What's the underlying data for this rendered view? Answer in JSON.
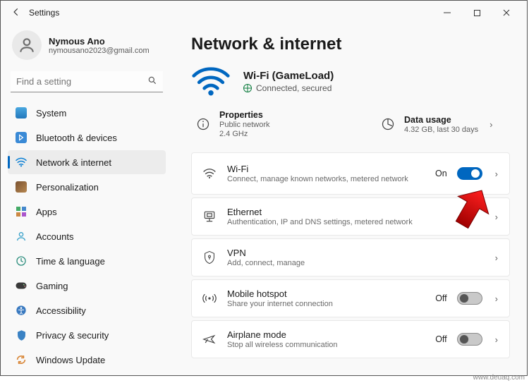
{
  "window": {
    "title": "Settings"
  },
  "profile": {
    "name": "Nymous Ano",
    "email": "nymousano2023@gmail.com"
  },
  "search": {
    "placeholder": "Find a setting"
  },
  "nav": {
    "items": [
      {
        "label": "System"
      },
      {
        "label": "Bluetooth & devices"
      },
      {
        "label": "Network & internet",
        "active": true
      },
      {
        "label": "Personalization"
      },
      {
        "label": "Apps"
      },
      {
        "label": "Accounts"
      },
      {
        "label": "Time & language"
      },
      {
        "label": "Gaming"
      },
      {
        "label": "Accessibility"
      },
      {
        "label": "Privacy & security"
      },
      {
        "label": "Windows Update"
      }
    ]
  },
  "page": {
    "heading": "Network & internet",
    "hero": {
      "ssid": "Wi-Fi (GameLoad)",
      "status": "Connected, secured"
    },
    "props": {
      "title": "Properties",
      "sub1": "Public network",
      "sub2": "2.4 GHz"
    },
    "usage": {
      "title": "Data usage",
      "sub": "4.32 GB, last 30 days"
    },
    "cards": {
      "wifi": {
        "title": "Wi-Fi",
        "sub": "Connect, manage known networks, metered network",
        "state": "On"
      },
      "eth": {
        "title": "Ethernet",
        "sub": "Authentication, IP and DNS settings, metered network"
      },
      "vpn": {
        "title": "VPN",
        "sub": "Add, connect, manage"
      },
      "hotspot": {
        "title": "Mobile hotspot",
        "sub": "Share your internet connection",
        "state": "Off"
      },
      "airplane": {
        "title": "Airplane mode",
        "sub": "Stop all wireless communication",
        "state": "Off"
      }
    }
  },
  "watermark": "www.deuaq.com"
}
